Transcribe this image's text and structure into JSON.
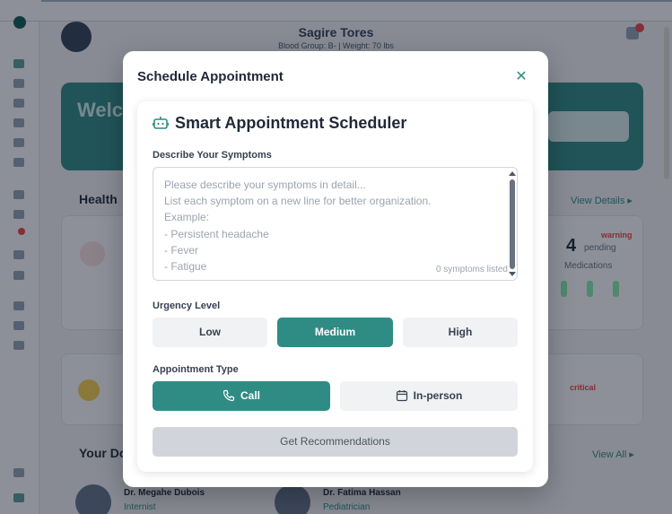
{
  "background": {
    "patient_name": "Sagire Tores",
    "patient_meta": "Blood Group: B- | Weight: 70 lbs",
    "welcome_title": "Welc",
    "health_section_title": "Health",
    "view_details": "View Details ▸",
    "pending_count": "4",
    "pending_label": "pending",
    "medications_label": "Medications",
    "warning_label": "warning",
    "critical_label": "critical",
    "doctors_section_title": "Your Do",
    "view_all": "View All ▸",
    "doctors": [
      {
        "name": "Dr. Megahe Dubois",
        "specialty": "Internist"
      },
      {
        "name": "Dr. Fatima Hassan",
        "specialty": "Pediatrician"
      }
    ]
  },
  "modal": {
    "title": "Schedule Appointment",
    "close_icon": "x-icon",
    "scheduler": {
      "icon": "robot-icon",
      "title": "Smart Appointment Scheduler",
      "symptoms_label": "Describe Your Symptoms",
      "symptoms_placeholder": "Please describe your symptoms in detail...\nList each symptom on a new line for better organization.\nExample:\n- Persistent headache\n- Fever\n- Fatigue",
      "symptoms_value": "",
      "symptom_count": "0 symptoms listed",
      "urgency_label": "Urgency Level",
      "urgency_options": [
        "Low",
        "Medium",
        "High"
      ],
      "urgency_selected": "Medium",
      "type_label": "Appointment Type",
      "type_options": [
        {
          "label": "Call",
          "icon": "phone-icon"
        },
        {
          "label": "In-person",
          "icon": "calendar-icon"
        }
      ],
      "type_selected": "Call",
      "submit_label": "Get Recommendations"
    }
  },
  "colors": {
    "accent": "#2f8c84",
    "overlay": "rgba(17,24,39,0.48)",
    "disabled_button": "#d1d5db"
  }
}
